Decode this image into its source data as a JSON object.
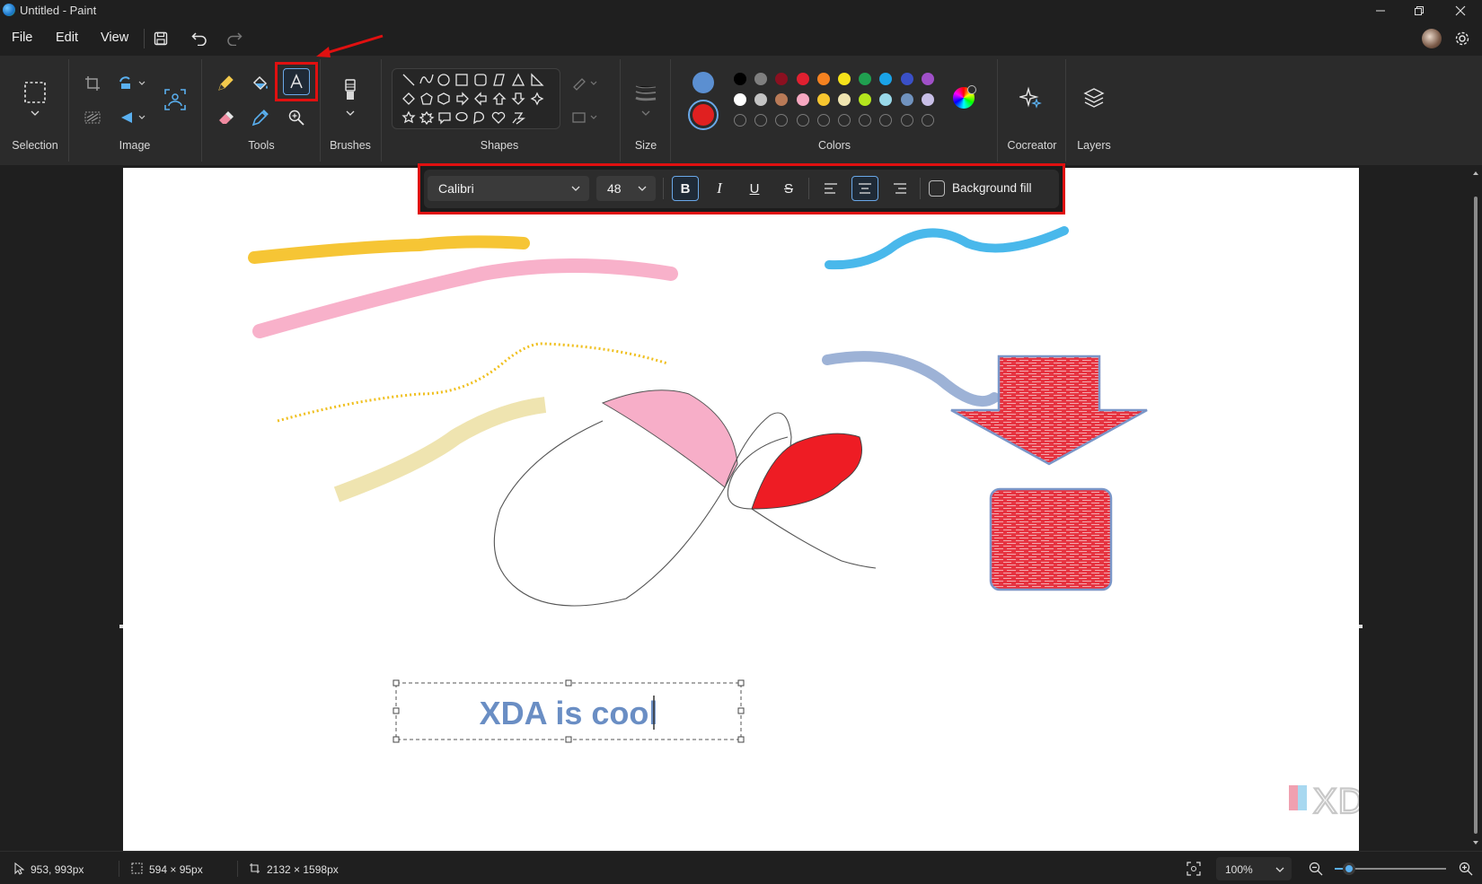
{
  "window": {
    "title": "Untitled - Paint"
  },
  "menu": {
    "file": "File",
    "edit": "Edit",
    "view": "View"
  },
  "ribbon": {
    "groups": {
      "selection": "Selection",
      "image": "Image",
      "tools": "Tools",
      "brushes": "Brushes",
      "shapes": "Shapes",
      "size": "Size",
      "colors": "Colors",
      "cocreator": "Cocreator",
      "layers": "Layers"
    },
    "primary_color": "#5b8fd1",
    "secondary_color": "#e02020",
    "palette_row1": [
      "#000000",
      "#7f7f7f",
      "#8b1020",
      "#e02030",
      "#f58220",
      "#f5e21a",
      "#20a050",
      "#1aa3e8",
      "#3a50c8",
      "#a050c8"
    ],
    "palette_row2": [
      "#ffffff",
      "#c3c3c3",
      "#b97a57",
      "#f6a7c0",
      "#f7c62f",
      "#efe4b0",
      "#b5e61d",
      "#99d9ea",
      "#7092be",
      "#c8bfe7"
    ]
  },
  "text_toolbar": {
    "font": "Calibri",
    "size": "48",
    "background_fill": "Background fill",
    "bold_active": true,
    "align": "center"
  },
  "canvas": {
    "text_content": "XDA is cool",
    "watermark": "XDA"
  },
  "status": {
    "cursor": "953, 993px",
    "selection_size": "594 × 95px",
    "canvas_size": "2132 × 1598px",
    "zoom": "100%"
  }
}
